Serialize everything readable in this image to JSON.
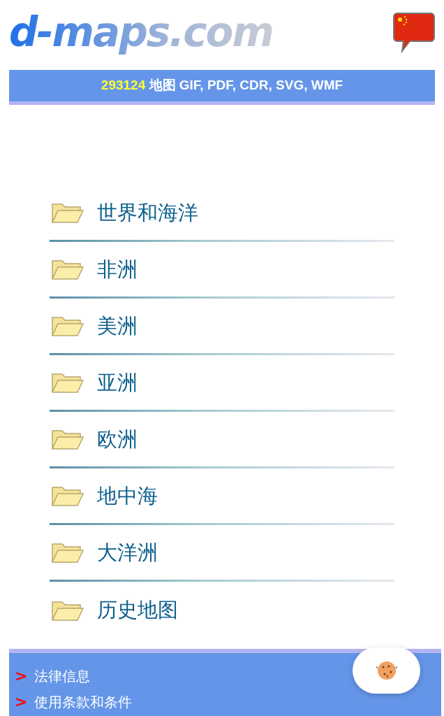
{
  "logo": {
    "text": "d-maps.com"
  },
  "banner": {
    "count": "293124",
    "text": "地图 GIF, PDF, CDR, SVG, WMF"
  },
  "categories": [
    {
      "label": "世界和海洋"
    },
    {
      "label": "非洲"
    },
    {
      "label": "美洲"
    },
    {
      "label": "亚洲"
    },
    {
      "label": "欧洲"
    },
    {
      "label": "地中海"
    },
    {
      "label": "大洋洲"
    },
    {
      "label": "历史地图"
    }
  ],
  "footer_links": [
    {
      "marker": ">",
      "label": "法律信息"
    },
    {
      "marker": ">",
      "label": "使用条款和条件"
    }
  ]
}
